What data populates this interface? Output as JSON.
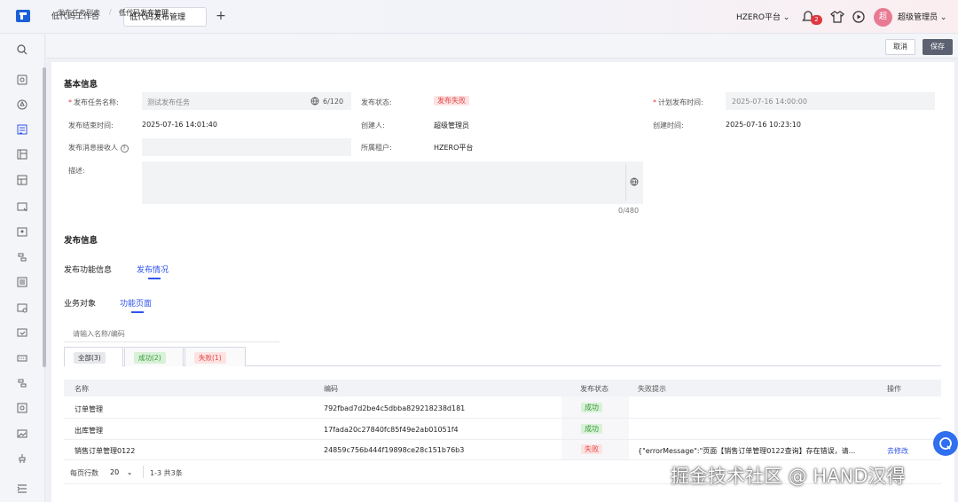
{
  "tabs": [
    {
      "label": "低代码工作台"
    },
    {
      "label": "低代码发布管理"
    }
  ],
  "topbar": {
    "tenant": "HZERO平台",
    "notification_count": "2",
    "avatar_text": "超",
    "user_name": "超级管理员"
  },
  "breadcrumb": {
    "parent": "发布任务列表",
    "sep": "/",
    "current": "低代码发布管理"
  },
  "actions": {
    "cancel": "取消",
    "save": "保存"
  },
  "basic": {
    "title": "基本信息",
    "task_name_label": "发布任务名称:",
    "task_name_value": "测试发布任务",
    "task_name_count": "6/120",
    "status_label": "发布状态:",
    "status_value": "发布失败",
    "plan_time_label": "计划发布时间:",
    "plan_time_value": "2025-07-16 14:00:00",
    "end_time_label": "发布结束时间:",
    "end_time_value": "2025-07-16 14:01:40",
    "creator_label": "创建人:",
    "creator_value": "超级管理员",
    "created_label": "创建时间:",
    "created_value": "2025-07-16 10:23:10",
    "receiver_label": "发布消息接收人",
    "receiver_help": "?",
    "tenant_label": "所属租户:",
    "tenant_value": "HZERO平台",
    "desc_label": "描述:",
    "desc_count": "0/480"
  },
  "publish": {
    "title": "发布信息",
    "tabs": [
      {
        "label": "发布功能信息"
      },
      {
        "label": "发布情况"
      }
    ],
    "subtabs": [
      {
        "label": "业务对象"
      },
      {
        "label": "功能页面"
      }
    ],
    "search_placeholder": "请输入名称/编码",
    "filters": [
      {
        "label": "全部(3)"
      },
      {
        "label": "成功(2)"
      },
      {
        "label": "失败(1)"
      }
    ]
  },
  "table": {
    "columns": [
      "名称",
      "编码",
      "发布状态",
      "失败提示",
      "操作"
    ],
    "rows": [
      {
        "name": "订单管理",
        "code": "792fbad7d2be4c5dbba829218238d181",
        "status": "成功",
        "tip": "",
        "action": ""
      },
      {
        "name": "出库管理",
        "code": "17fada20c27840fc85f49e2ab01051f4",
        "status": "成功",
        "tip": "",
        "action": ""
      },
      {
        "name": "销售订单管理0122",
        "code": "24859c756b444f19898ce28c151b76b3",
        "status": "失败",
        "tip": "{\"errorMessage\":\"页面【销售订单管理0122查询】存在错误，请...",
        "action": "去修改"
      }
    ],
    "page_size_label": "每页行数",
    "page_size": "20",
    "range": "1-3",
    "total": "共3条"
  },
  "watermark": "掘金技术社区 @ HAND汉得",
  "colors": {
    "accent": "#2f54eb",
    "danger": "#e34848",
    "success": "#3a9a3a",
    "save_button": "#5b6170"
  }
}
